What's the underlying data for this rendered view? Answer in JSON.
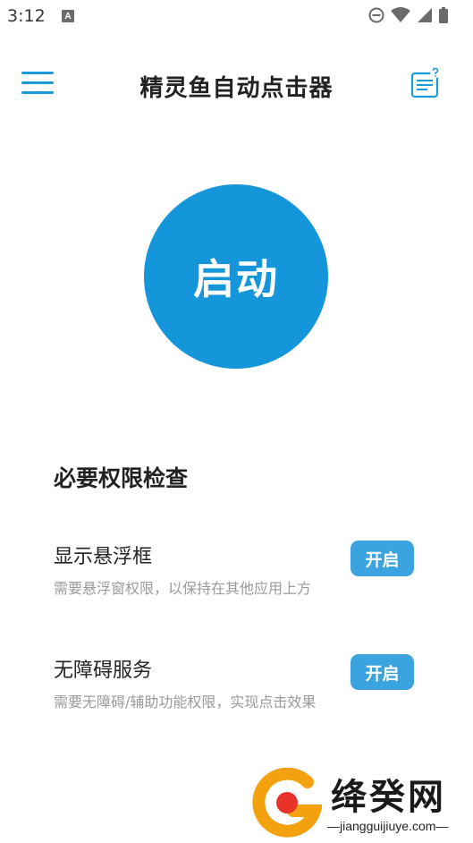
{
  "status_bar": {
    "time": "3:12",
    "notification_icon": "a-letter-icon",
    "right_icons": [
      "do-not-disturb-icon",
      "wifi-icon",
      "cellular-signal-icon",
      "battery-icon"
    ]
  },
  "app_bar": {
    "title": "精灵鱼自动点击器",
    "menu_icon": "hamburger-menu-icon",
    "help_icon": "help-document-icon"
  },
  "main": {
    "start_label": "启动",
    "start_color": "#1696da"
  },
  "permissions": {
    "title": "必要权限检查",
    "items": [
      {
        "title": "显示悬浮框",
        "description": "需要悬浮窗权限，以保持在其他应用上方",
        "button_label": "开启"
      },
      {
        "title": "无障碍服务",
        "description": "需要无障碍/辅助功能权限，实现点击效果",
        "button_label": "开启"
      }
    ]
  },
  "watermark": {
    "name": "绛癸网",
    "url": "jiangguijiuye.com"
  },
  "colors": {
    "accent": "#1a9ad6",
    "button": "#3aa3e0",
    "muted_text": "#9a9a9a"
  }
}
